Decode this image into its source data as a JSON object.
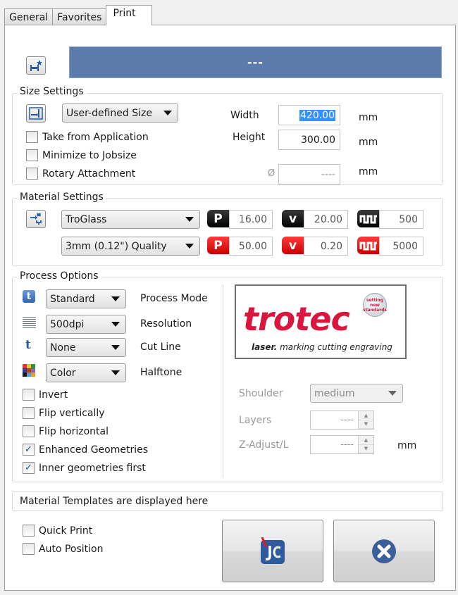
{
  "tabs": [
    {
      "label": "General",
      "active": false
    },
    {
      "label": "Favorites",
      "active": false
    },
    {
      "label": "Print",
      "active": true
    }
  ],
  "header": {
    "favorite_icon": "printer-star-icon",
    "job_name": "---"
  },
  "size_settings": {
    "title": "Size Settings",
    "size_icon": "resize-icon",
    "size_mode": "User-defined Size",
    "options": [
      {
        "label": "Take from Application",
        "checked": false
      },
      {
        "label": "Minimize to Jobsize",
        "checked": false
      },
      {
        "label": "Rotary Attachment",
        "checked": false
      }
    ],
    "width_label": "Width",
    "width_value": "420.00",
    "height_label": "Height",
    "height_value": "300.00",
    "diameter_symbol": "Ø",
    "diameter_value": "----",
    "unit": "mm"
  },
  "material_settings": {
    "title": "Material Settings",
    "material_icon": "material-settings-icon",
    "material": "TroGlass",
    "quality": "3mm (0.12\") Quality",
    "engrave": {
      "power_label": "P",
      "power": "16.00",
      "velocity_label": "v",
      "velocity": "20.00",
      "frequency_icon": "pulse-wave-icon",
      "frequency": "500",
      "color": "#000000"
    },
    "cut": {
      "power_label": "P",
      "power": "50.00",
      "velocity_label": "v",
      "velocity": "0.20",
      "frequency_icon": "pulse-wave-icon",
      "frequency": "5000",
      "color": "#e00000"
    }
  },
  "process_options": {
    "title": "Process Options",
    "rows": [
      {
        "icon": "process-mode-icon",
        "value": "Standard",
        "label": "Process Mode"
      },
      {
        "icon": "resolution-lines-icon",
        "value": "500dpi",
        "label": "Resolution"
      },
      {
        "icon": "cut-line-icon",
        "value": "None",
        "label": "Cut Line"
      },
      {
        "icon": "halftone-color-icon",
        "value": "Color",
        "label": "Halftone"
      }
    ],
    "checkboxes": [
      {
        "label": "Invert",
        "checked": false
      },
      {
        "label": "Flip vertically",
        "checked": false
      },
      {
        "label": "Flip horizontal",
        "checked": false
      },
      {
        "label": "Enhanced Geometries",
        "checked": true
      },
      {
        "label": "Inner geometries first",
        "checked": true
      }
    ],
    "logo": {
      "brand": "trotec",
      "tagline_bold": "laser.",
      "tagline": "marking cutting engraving",
      "seal": "setting new standards",
      "brand_color": "#d8163e"
    },
    "shoulder_label": "Shoulder",
    "shoulder_value": "medium",
    "layers_label": "Layers",
    "layers_value": "----",
    "zadjust_label": "Z-Adjust/L",
    "zadjust_value": "----",
    "unit": "mm"
  },
  "templates_message": "Material Templates are displayed here",
  "footer": {
    "quick_print": {
      "label": "Quick Print",
      "checked": false
    },
    "auto_position": {
      "label": "Auto Position",
      "checked": false
    },
    "print_button_icon": "job-control-icon",
    "cancel_button_icon": "close-icon"
  }
}
